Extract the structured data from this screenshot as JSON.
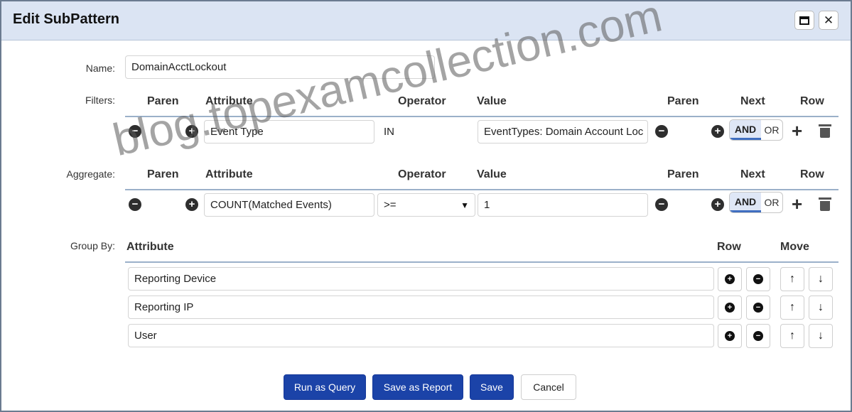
{
  "dialog": {
    "title": "Edit SubPattern"
  },
  "name": {
    "label": "Name:",
    "value": "DomainAcctLockout"
  },
  "filters": {
    "label": "Filters:",
    "headers": {
      "paren1": "Paren",
      "attribute": "Attribute",
      "operator": "Operator",
      "value": "Value",
      "paren2": "Paren",
      "next": "Next",
      "row": "Row"
    },
    "row": {
      "attribute": "Event Type",
      "operator": "IN",
      "value": "EventTypes: Domain Account Loc",
      "and": "AND",
      "or": "OR"
    }
  },
  "aggregate": {
    "label": "Aggregate:",
    "headers": {
      "paren1": "Paren",
      "attribute": "Attribute",
      "operator": "Operator",
      "value": "Value",
      "paren2": "Paren",
      "next": "Next",
      "row": "Row"
    },
    "row": {
      "attribute": "COUNT(Matched Events)",
      "operator": ">=",
      "value": "1",
      "and": "AND",
      "or": "OR"
    }
  },
  "group_by": {
    "label": "Group By:",
    "headers": {
      "attribute": "Attribute",
      "row": "Row",
      "move": "Move"
    },
    "rows": [
      {
        "attribute": "Reporting Device"
      },
      {
        "attribute": "Reporting IP"
      },
      {
        "attribute": "User"
      }
    ]
  },
  "buttons": {
    "run_query": "Run as Query",
    "save_report": "Save as Report",
    "save": "Save",
    "cancel": "Cancel"
  },
  "icons": {
    "plus_circle": "plus-circle-icon",
    "minus_circle": "minus-circle-icon",
    "trash": "trash-icon",
    "up": "arrow-up-icon",
    "down": "arrow-down-icon"
  },
  "colors": {
    "titlebar": "#dbe4f3",
    "primary": "#1b43a8",
    "header_line": "#9bb0c9"
  },
  "watermark": "blog.topexamcollection.com"
}
